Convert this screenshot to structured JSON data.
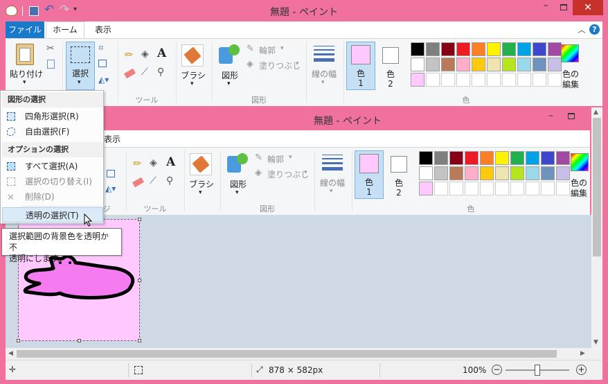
{
  "title": "無題 - ペイント",
  "tabs": {
    "file": "ファイル",
    "home": "ホーム",
    "view": "表示"
  },
  "clipboard": {
    "paste": "貼り付け"
  },
  "image": {
    "select": "選択"
  },
  "groups": {
    "tools": "ツール",
    "shapes": "図形",
    "colors": "色"
  },
  "brushes": {
    "label": "ブラシ"
  },
  "shapes": {
    "label": "図形",
    "outline": "輪郭",
    "fill": "塗りつぶし"
  },
  "size": {
    "label": "線の幅"
  },
  "color1": {
    "label": "色",
    "num": "1"
  },
  "color2": {
    "label": "色",
    "num": "2"
  },
  "edit_colors": {
    "line1": "色の",
    "line2": "編集"
  },
  "inner": {
    "title": "無題 - ペイント",
    "view_tab": "表示",
    "ji": "ジ"
  },
  "menu": {
    "header1": "図形の選択",
    "rect": "四角形選択(R)",
    "free": "自由選択(F)",
    "header2": "オプションの選択",
    "all": "すべて選択(A)",
    "invert": "選択の切り替え(I)",
    "delete": "削除(D)",
    "transparent": "透明の選択(T)"
  },
  "tooltip": {
    "line1": "選択範囲の背景色を透明か不",
    "line2": "透明にします。"
  },
  "status": {
    "size": "878 × 582px",
    "zoom": "100%"
  },
  "colors": {
    "frame": "#f0719e",
    "color1": "#ffc8ff",
    "color2": "#ffffff",
    "palette": [
      "#000000",
      "#7f7f7f",
      "#880015",
      "#ed1c24",
      "#ff7f27",
      "#fff200",
      "#22b14c",
      "#00a2e8",
      "#3f48cc",
      "#a349a4",
      "#ffffff",
      "#c3c3c3",
      "#b97a57",
      "#ffaec9",
      "#ffc90e",
      "#efe4b0",
      "#b5e61d",
      "#99d9ea",
      "#7092be",
      "#c8bfe7"
    ],
    "palette_row3": [
      "#ffc8ff",
      "",
      "",
      "",
      "",
      "",
      "",
      "",
      "",
      ""
    ]
  }
}
